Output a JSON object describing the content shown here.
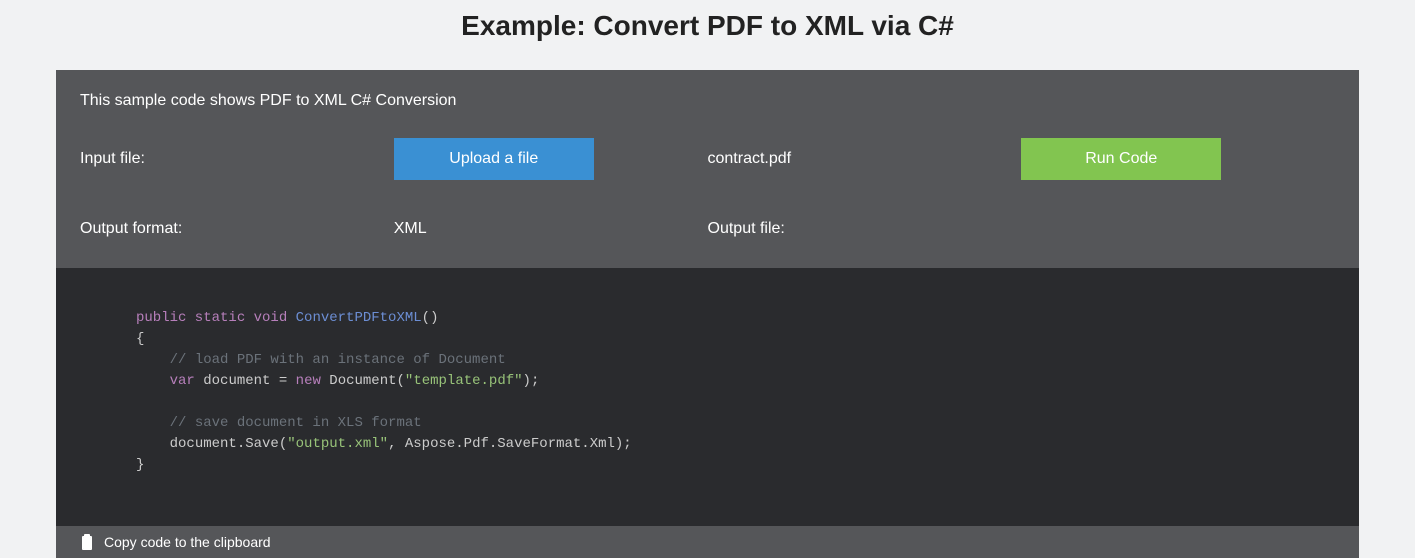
{
  "title": "Example: Convert PDF to XML via C#",
  "description": "This sample code shows PDF to XML C# Conversion",
  "labels": {
    "input_file": "Input file:",
    "output_format": "Output format:",
    "output_file": "Output file:"
  },
  "values": {
    "input_filename": "contract.pdf",
    "output_format": "XML",
    "output_filename": ""
  },
  "buttons": {
    "upload": "Upload a file",
    "run": "Run Code"
  },
  "code": {
    "t1": "public static void",
    "t2": "ConvertPDFtoXML",
    "t3": "()",
    "t4": "{",
    "t5": "// load PDF with an instance of Document",
    "t6": "var",
    "t7": "document",
    "t8": "=",
    "t9": "new",
    "t10": "Document(",
    "t11": "\"template.pdf\"",
    "t12": ");",
    "t13": "// save document in XLS format",
    "t14": "document.Save(",
    "t15": "\"output.xml\"",
    "t16": ", Aspose.Pdf.SaveFormat.Xml);",
    "t17": "}"
  },
  "copy_label": "Copy code to the clipboard"
}
